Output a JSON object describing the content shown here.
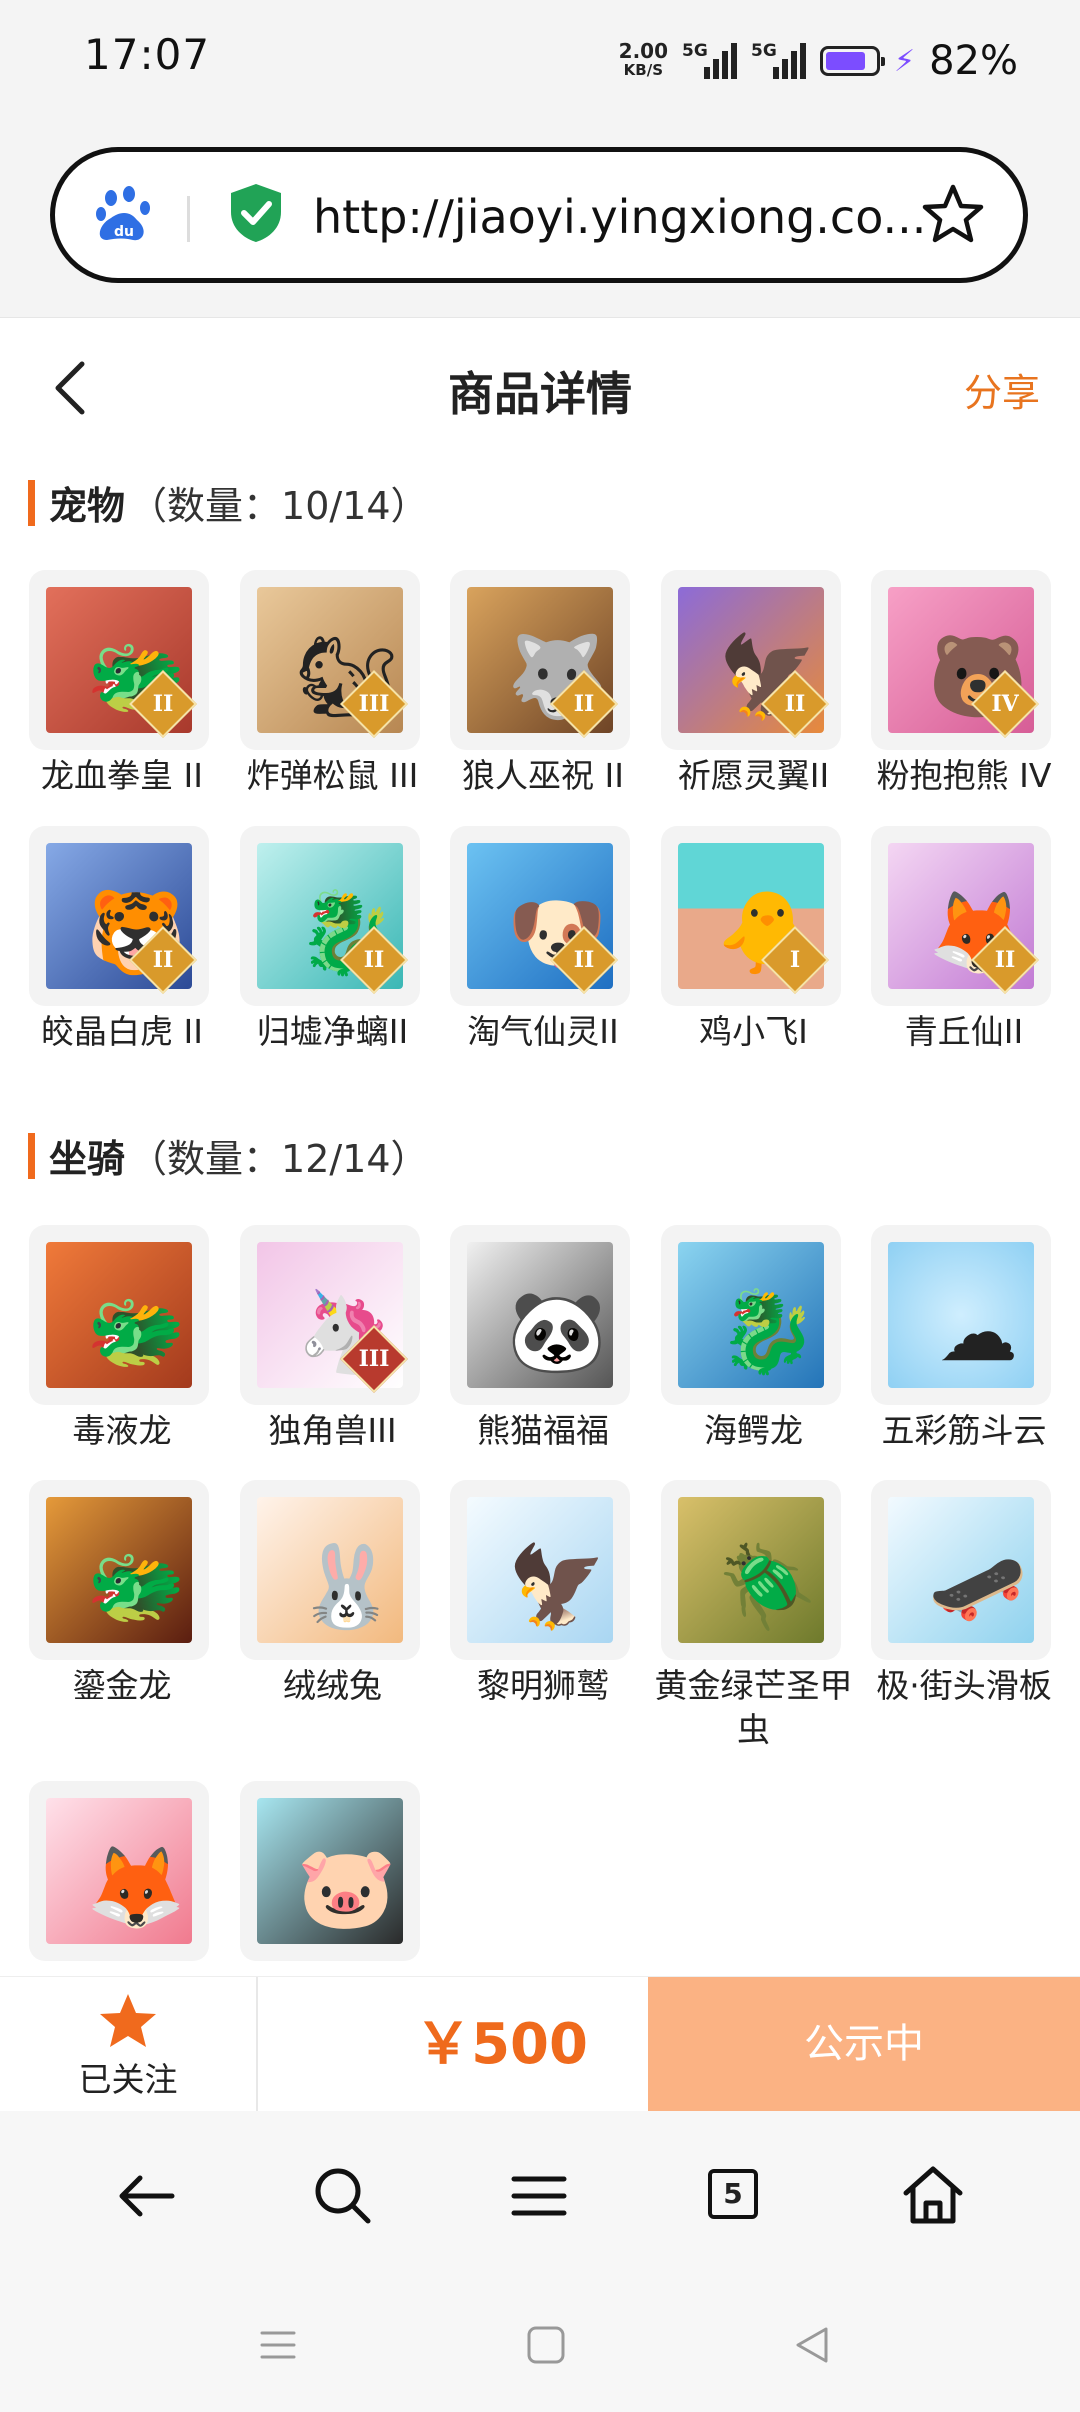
{
  "status_bar": {
    "time": "17:07",
    "net_speed_value": "2.00",
    "net_speed_unit": "KB/S",
    "sim1": "5G",
    "sim2": "5G",
    "battery_level": 0.82,
    "battery_percent": "82%",
    "accent_color": "#7c4dff"
  },
  "browser": {
    "url": "http://jiaoyi.yingxiong.co...",
    "tab_count": "5"
  },
  "header": {
    "title": "商品详情",
    "share": "分享"
  },
  "pets": {
    "name": "宠物",
    "count": "（数量：10/14）",
    "items": [
      {
        "label": "龙血拳皇 II",
        "tier": "II",
        "icon": "dragon-boxer-icon"
      },
      {
        "label": "炸弹松鼠 III",
        "tier": "III",
        "icon": "bomb-squirrel-icon"
      },
      {
        "label": "狼人巫祝 II",
        "tier": "II",
        "icon": "werewolf-shaman-icon"
      },
      {
        "label": "祈愿灵翼II",
        "tier": "II",
        "icon": "wish-bird-icon"
      },
      {
        "label": "粉抱抱熊 IV",
        "tier": "IV",
        "icon": "pink-bear-icon"
      },
      {
        "label": "皎晶白虎 II",
        "tier": "II",
        "icon": "crystal-tiger-icon"
      },
      {
        "label": "归墟净螭II",
        "tier": "II",
        "icon": "water-dragon-icon"
      },
      {
        "label": "淘气仙灵II",
        "tier": "II",
        "icon": "blue-fairy-icon"
      },
      {
        "label": "鸡小飞I",
        "tier": "I",
        "icon": "chick-icon"
      },
      {
        "label": "青丘仙II",
        "tier": "II",
        "icon": "fox-fairy-icon"
      }
    ]
  },
  "mounts": {
    "name": "坐骑",
    "count": "（数量：12/14）",
    "items": [
      {
        "label": "毒液龙",
        "tier": "",
        "icon": "venom-dragon-icon"
      },
      {
        "label": "独角兽III",
        "tier": "III",
        "icon": "unicorn-icon"
      },
      {
        "label": "熊猫福福",
        "tier": "",
        "icon": "panda-icon"
      },
      {
        "label": "海鳄龙",
        "tier": "",
        "icon": "sea-dragon-icon"
      },
      {
        "label": "五彩筋斗云",
        "tier": "",
        "icon": "cloud-icon"
      },
      {
        "label": "鎏金龙",
        "tier": "",
        "icon": "gold-dragon-icon"
      },
      {
        "label": "绒绒兔",
        "tier": "",
        "icon": "rabbit-icon"
      },
      {
        "label": "黎明狮鹫",
        "tier": "",
        "icon": "griffin-icon"
      },
      {
        "label": "黄金绿芒圣甲虫",
        "tier": "",
        "icon": "scarab-icon"
      },
      {
        "label": "极·街头滑板",
        "tier": "",
        "icon": "skateboard-icon"
      },
      {
        "label": "",
        "tier": "",
        "icon": "pink-fox-icon"
      },
      {
        "label": "",
        "tier": "",
        "icon": "black-pig-icon"
      }
    ]
  },
  "action_bar": {
    "follow_label": "已关注",
    "price": "￥500",
    "status_button": "公示中",
    "accent_color": "#ef6a1c",
    "button_color": "#fbb283"
  }
}
